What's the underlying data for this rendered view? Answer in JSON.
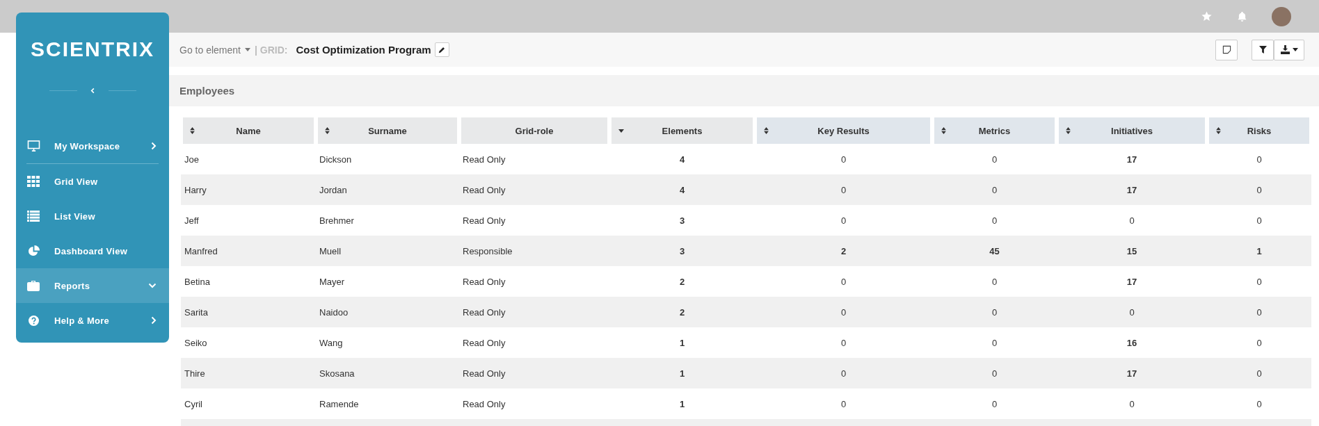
{
  "brand": {
    "logo": "SCIENTRIX"
  },
  "sidebar": {
    "items": [
      {
        "label": "My Workspace",
        "kind": "group",
        "expanded": false,
        "selected": false
      },
      {
        "label": "Grid View",
        "kind": "link",
        "selected": false
      },
      {
        "label": "List View",
        "kind": "link",
        "selected": false
      },
      {
        "label": "Dashboard View",
        "kind": "link",
        "selected": false
      },
      {
        "label": "Reports",
        "kind": "group",
        "expanded": true,
        "selected": true
      },
      {
        "label": "Help & More",
        "kind": "group",
        "expanded": false,
        "selected": false
      }
    ]
  },
  "toolbar": {
    "goto": "Go to element",
    "grid_label": "| GRID:",
    "grid_name": "Cost Optimization Program"
  },
  "panel": {
    "title": "Employees"
  },
  "table": {
    "columns": [
      {
        "label": "Name",
        "kind": "info",
        "sortable": true,
        "sorted": false
      },
      {
        "label": "Surname",
        "kind": "info",
        "sortable": true,
        "sorted": false
      },
      {
        "label": "Grid-role",
        "kind": "info",
        "sortable": false
      },
      {
        "label": "Elements",
        "kind": "info",
        "sortable": true,
        "sorted": true
      },
      {
        "label": "Key Results",
        "kind": "stat",
        "sortable": true,
        "sorted": false
      },
      {
        "label": "Metrics",
        "kind": "stat",
        "sortable": true,
        "sorted": false
      },
      {
        "label": "Initiatives",
        "kind": "stat",
        "sortable": true,
        "sorted": false
      },
      {
        "label": "Risks",
        "kind": "stat",
        "sortable": true,
        "sorted": false
      }
    ],
    "rows": [
      {
        "name": "Joe",
        "surname": "Dickson",
        "role": "Read Only",
        "counts": [
          {
            "text": "4",
            "bold": true
          },
          {
            "text": "0",
            "bold": false
          },
          {
            "text": "0",
            "bold": false
          },
          {
            "text": "17",
            "bold": true
          },
          {
            "text": "0",
            "bold": false
          }
        ]
      },
      {
        "name": "Harry",
        "surname": "Jordan",
        "role": "Read Only",
        "counts": [
          {
            "text": "4",
            "bold": true
          },
          {
            "text": "0",
            "bold": false
          },
          {
            "text": "0",
            "bold": false
          },
          {
            "text": "17",
            "bold": true
          },
          {
            "text": "0",
            "bold": false
          }
        ]
      },
      {
        "name": "Jeff",
        "surname": "Brehmer",
        "role": "Read Only",
        "counts": [
          {
            "text": "3",
            "bold": true
          },
          {
            "text": "0",
            "bold": false
          },
          {
            "text": "0",
            "bold": false
          },
          {
            "text": "0",
            "bold": false
          },
          {
            "text": "0",
            "bold": false
          }
        ]
      },
      {
        "name": "Manfred",
        "surname": "Muell",
        "role": "Responsible",
        "counts": [
          {
            "text": "3",
            "bold": true
          },
          {
            "text": "2",
            "bold": true
          },
          {
            "text": "45",
            "bold": true
          },
          {
            "text": "15",
            "bold": true
          },
          {
            "text": "1",
            "bold": true
          }
        ]
      },
      {
        "name": "Betina",
        "surname": "Mayer",
        "role": "Read Only",
        "counts": [
          {
            "text": "2",
            "bold": true
          },
          {
            "text": "0",
            "bold": false
          },
          {
            "text": "0",
            "bold": false
          },
          {
            "text": "17",
            "bold": true
          },
          {
            "text": "0",
            "bold": false
          }
        ]
      },
      {
        "name": "Sarita",
        "surname": "Naidoo",
        "role": "Read Only",
        "counts": [
          {
            "text": "2",
            "bold": true
          },
          {
            "text": "0",
            "bold": false
          },
          {
            "text": "0",
            "bold": false
          },
          {
            "text": "0",
            "bold": false
          },
          {
            "text": "0",
            "bold": false
          }
        ]
      },
      {
        "name": "Seiko",
        "surname": "Wang",
        "role": "Read Only",
        "counts": [
          {
            "text": "1",
            "bold": true
          },
          {
            "text": "0",
            "bold": false
          },
          {
            "text": "0",
            "bold": false
          },
          {
            "text": "16",
            "bold": true
          },
          {
            "text": "0",
            "bold": false
          }
        ]
      },
      {
        "name": "Thire",
        "surname": "Skosana",
        "role": "Read Only",
        "counts": [
          {
            "text": "1",
            "bold": true
          },
          {
            "text": "0",
            "bold": false
          },
          {
            "text": "0",
            "bold": false
          },
          {
            "text": "17",
            "bold": true
          },
          {
            "text": "0",
            "bold": false
          }
        ]
      },
      {
        "name": "Cyril",
        "surname": "Ramende",
        "role": "Read Only",
        "counts": [
          {
            "text": "1",
            "bold": true
          },
          {
            "text": "0",
            "bold": false
          },
          {
            "text": "0",
            "bold": false
          },
          {
            "text": "0",
            "bold": false
          },
          {
            "text": "0",
            "bold": false
          }
        ]
      }
    ]
  }
}
